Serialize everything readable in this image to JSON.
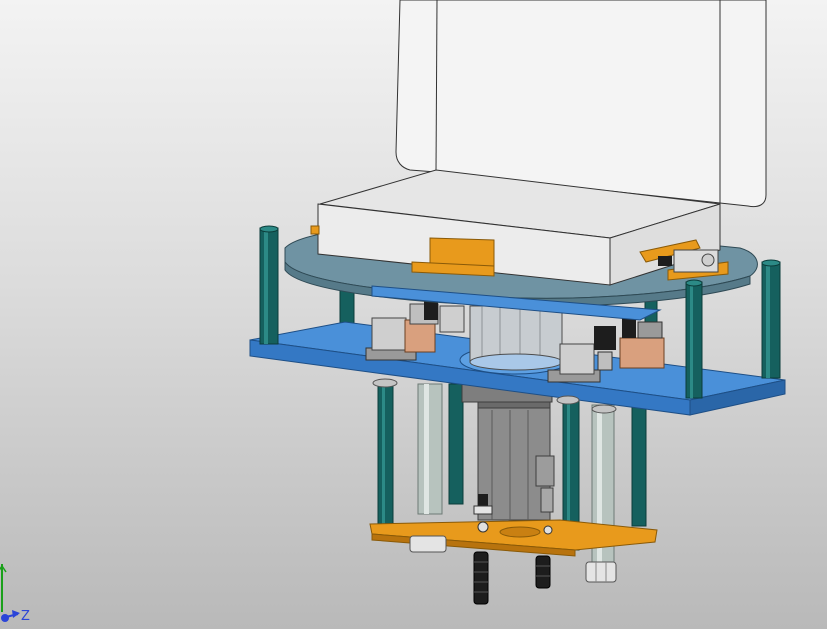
{
  "viewport": {
    "content": "cad-assembly-model",
    "background_top": "#f3f3f3",
    "background_bottom": "#b9b9b9"
  },
  "triad": {
    "z_label": "Z",
    "z_color": "#2b45d8",
    "y_color": "#1aa01a"
  },
  "colors": {
    "upper_plate": "#4a90d9",
    "round_plate": "#6f93a3",
    "bracket_orange": "#e89a1c",
    "standoff_teal": "#15605e",
    "box_white": "#f4f4f4",
    "motor_gray": "#8c8c8c",
    "rod_gray": "#b7c3be",
    "clamp_copper": "#d9a07e"
  }
}
